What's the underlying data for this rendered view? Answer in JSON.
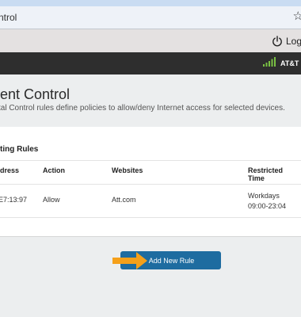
{
  "browser": {
    "url_fragment": "ntrol",
    "bookmark_icon": "star-outline-icon"
  },
  "topbar": {
    "logout_label": "Logo",
    "power_icon": "power-icon"
  },
  "navbar": {
    "carrier": "AT&T",
    "signal_icon": "signal-bars-icon",
    "signal_color": "#7ac143"
  },
  "page": {
    "title": "ent Control",
    "description": "tal Control rules define policies to allow/deny Internet access for selected devices."
  },
  "rules": {
    "section_title": "ting Rules",
    "columns": [
      "dress",
      "Action",
      "Websites",
      "Restricted Time"
    ],
    "rows": [
      {
        "address": "E7:13:97",
        "action": "Allow",
        "websites": "Att.com",
        "time": "Workdays 09:00-23:04"
      }
    ]
  },
  "add_button": {
    "label": "Add New Rule",
    "color": "#1e6ca0",
    "arrow_color": "#f5a01a"
  }
}
